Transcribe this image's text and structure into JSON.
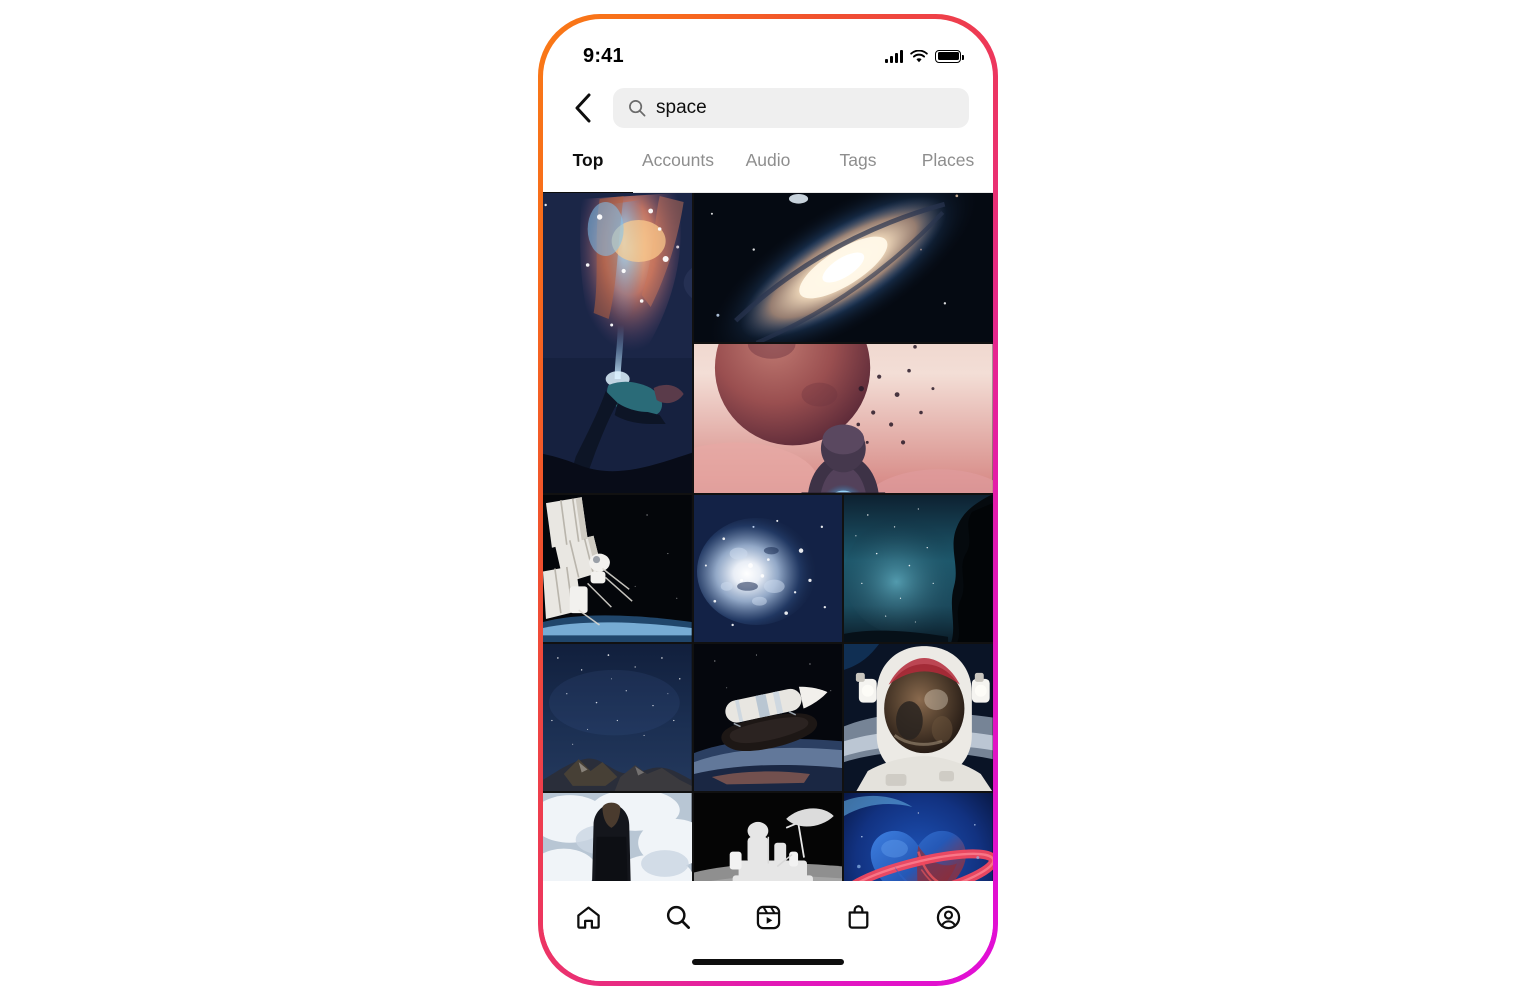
{
  "device": {
    "frame_gradient_start": "#f97a16",
    "frame_gradient_end": "#e10ed8"
  },
  "status_bar": {
    "time": "9:41",
    "signal_icon": "cellular-bars-icon",
    "wifi_icon": "wifi-icon",
    "battery_icon": "battery-full-icon"
  },
  "header": {
    "back_icon": "chevron-left-icon",
    "search": {
      "icon": "search-icon",
      "value": "space",
      "placeholder": "Search"
    }
  },
  "tabs": {
    "active_index": 0,
    "items": [
      {
        "label": "Top"
      },
      {
        "label": "Accounts"
      },
      {
        "label": "Audio"
      },
      {
        "label": "Tags"
      },
      {
        "label": "Places"
      }
    ]
  },
  "grid": {
    "sections": [
      {
        "layout": "feature",
        "tiles": [
          {
            "name": "andromeda-galaxy",
            "alt": "Spiral galaxy tilted in deep space"
          },
          {
            "name": "astronaut-red-planet",
            "alt": "Astronaut facing a large red planet above pink clouds"
          },
          {
            "name": "nebula-woman",
            "alt": "Woman leaning back exhaling a cosmic nebula"
          }
        ]
      },
      {
        "layout": "triple",
        "tiles": [
          {
            "name": "iss-solar-panel",
            "alt": "Space station module against black space"
          },
          {
            "name": "blue-galaxy-cluster",
            "alt": "Bright blue star cluster"
          },
          {
            "name": "milky-way-treeline",
            "alt": "Milky Way over dark treeline"
          }
        ]
      },
      {
        "layout": "triple",
        "tiles": [
          {
            "name": "starry-mountain-ridge",
            "alt": "Starry night sky over a mountain ridge"
          },
          {
            "name": "spacecraft-over-earth",
            "alt": "Rocket stage orbiting above Earth"
          },
          {
            "name": "astronaut-helmet-selfie",
            "alt": "Astronaut helmet visor reflection spacewalk"
          }
        ]
      },
      {
        "layout": "triple",
        "tiles": [
          {
            "name": "figure-in-clouds",
            "alt": "Dark silhouette against bright clouds"
          },
          {
            "name": "lunar-rover-bw",
            "alt": "Black and white astronaut with lunar rover"
          },
          {
            "name": "heart-planet-ring",
            "alt": "Blue and red heart shaped planet with a ring"
          }
        ]
      }
    ]
  },
  "bottom_nav": {
    "active_index": 1,
    "items": [
      {
        "icon": "home-icon",
        "label": "Home"
      },
      {
        "icon": "search-icon",
        "label": "Search"
      },
      {
        "icon": "reels-icon",
        "label": "Reels"
      },
      {
        "icon": "shop-bag-icon",
        "label": "Shop"
      },
      {
        "icon": "profile-icon",
        "label": "Profile"
      }
    ]
  },
  "home_indicator": {
    "name": "home-indicator"
  }
}
